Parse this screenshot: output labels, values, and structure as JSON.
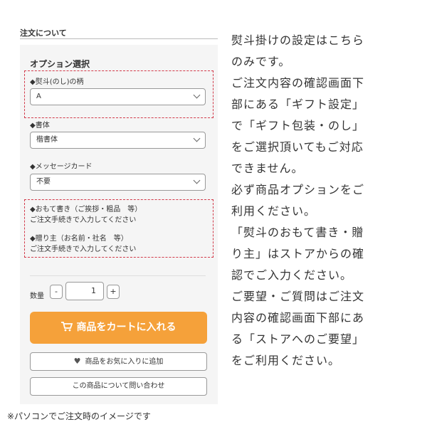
{
  "section_title": "注文について",
  "options": {
    "heading": "オプション選択",
    "fields": [
      {
        "label": "◆熨斗(のし)の柄",
        "value": "A"
      },
      {
        "label": "◆書体",
        "value": "楷書体"
      },
      {
        "label": "◆メッセージカード",
        "value": "不要"
      }
    ],
    "notes": [
      {
        "title": "◆おもて書き（ご挨拶・粗品　等）",
        "sub": "ご注文手続きで入力してください"
      },
      {
        "title": "◆贈り主（お名前・社名　等）",
        "sub": "ご注文手続きで入力してください"
      }
    ]
  },
  "quantity": {
    "label": "数量",
    "minus": "-",
    "value": "1",
    "plus": "+"
  },
  "buttons": {
    "cart": "商品をカートに入れる",
    "favorite": "商品をお気に入りに追加",
    "inquiry": "この商品について問い合わせ"
  },
  "caption": "※パソコンでご注文時のイメージです",
  "explanation_lines": [
    "熨斗掛けの設定はこちら",
    "のみです。",
    "ご注文内容の確認画面下",
    "部にある「ギフト設定」",
    "で「ギフト包装・のし」",
    "をご選択頂いてもご対応",
    "できません。",
    "必ず商品オプションをご",
    "利用ください。",
    "「熨斗のおもて書き・贈",
    "り主」はストアからの確",
    "認でご入力ください。",
    "ご要望・ご質問はご注文",
    "内容の確認画面下部にあ",
    "る「ストアへのご要望」",
    "をご利用ください。"
  ],
  "colors": {
    "cart_button": "#f5a13a",
    "dashed_highlight": "#d23a4a",
    "panel_bg": "#f5f5f5"
  },
  "icons": [
    "cart-icon",
    "heart-icon",
    "chevron-down-icon"
  ]
}
